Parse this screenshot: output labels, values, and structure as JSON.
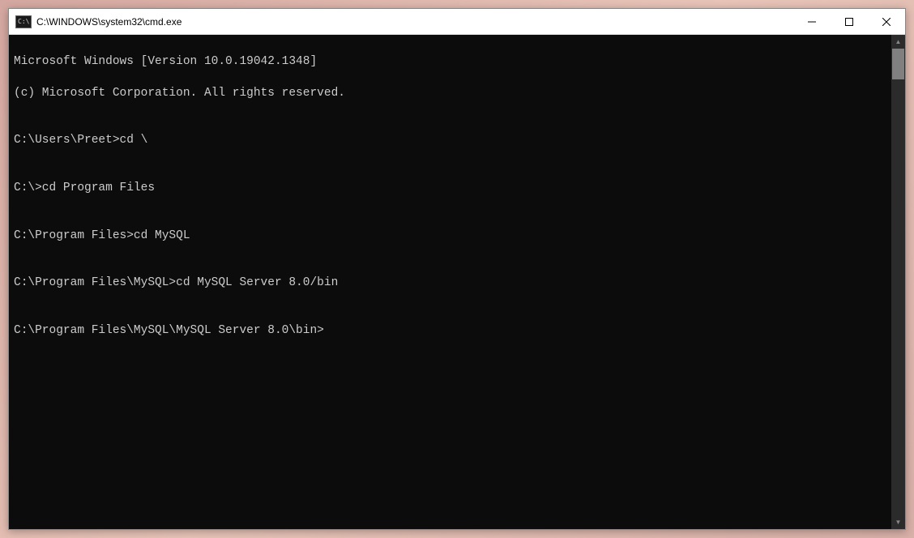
{
  "titlebar": {
    "icon_text": "C:\\",
    "title": "C:\\WINDOWS\\system32\\cmd.exe"
  },
  "terminal": {
    "lines": [
      "Microsoft Windows [Version 10.0.19042.1348]",
      "(c) Microsoft Corporation. All rights reserved.",
      "",
      "C:\\Users\\Preet>cd \\",
      "",
      "C:\\>cd Program Files",
      "",
      "C:\\Program Files>cd MySQL",
      "",
      "C:\\Program Files\\MySQL>cd MySQL Server 8.0/bin",
      "",
      "C:\\Program Files\\MySQL\\MySQL Server 8.0\\bin>"
    ]
  }
}
